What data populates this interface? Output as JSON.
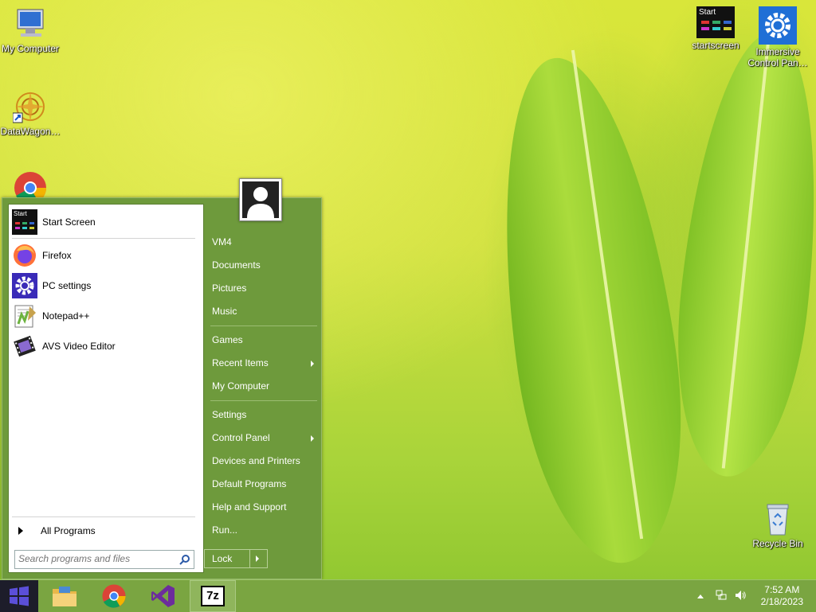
{
  "desktop": {
    "icons": [
      {
        "label": "My Computer",
        "icon": "computer-icon"
      },
      {
        "label": "DataWagon…",
        "icon": "datawagon-icon"
      },
      {
        "label": "startscreen",
        "icon": "startscreen-icon"
      },
      {
        "label": "Immersive Control Pan…",
        "icon": "gear-icon"
      },
      {
        "label": "Recycle Bin",
        "icon": "recycle-bin-icon"
      },
      {
        "label": "",
        "icon": "chrome-icon"
      }
    ]
  },
  "start_menu": {
    "pinned": [
      {
        "label": "Start Screen",
        "icon": "startscreen-icon"
      },
      {
        "label": "Firefox",
        "icon": "firefox-icon"
      },
      {
        "label": "PC settings",
        "icon": "gear-icon"
      },
      {
        "label": "Notepad++",
        "icon": "notepadpp-icon"
      },
      {
        "label": "AVS Video Editor",
        "icon": "film-icon"
      }
    ],
    "start_tile_text": "Start",
    "all_programs": "All Programs",
    "search_placeholder": "Search programs and files",
    "right": [
      {
        "label": "VM4"
      },
      {
        "label": "Documents"
      },
      {
        "label": "Pictures"
      },
      {
        "label": "Music"
      },
      {
        "label": "Games"
      },
      {
        "label": "Recent Items"
      },
      {
        "label": "My Computer"
      },
      {
        "label": "Settings"
      },
      {
        "label": "Control Panel"
      },
      {
        "label": "Devices and Printers"
      },
      {
        "label": "Default Programs"
      },
      {
        "label": "Help and Support"
      },
      {
        "label": "Run..."
      }
    ],
    "lock_label": "Lock"
  },
  "taskbar": {
    "buttons": [
      "windows-start-icon",
      "file-explorer-icon",
      "chrome-icon",
      "visual-studio-icon",
      "7zip-icon"
    ],
    "sevenzip_text": "7z",
    "clock_time": "7:52 AM",
    "clock_date": "2/18/2023"
  },
  "colors": {
    "menu_green": "#6e9a3c",
    "taskbar_green": "#7aa541",
    "accent_purple": "#3a2bb8"
  }
}
